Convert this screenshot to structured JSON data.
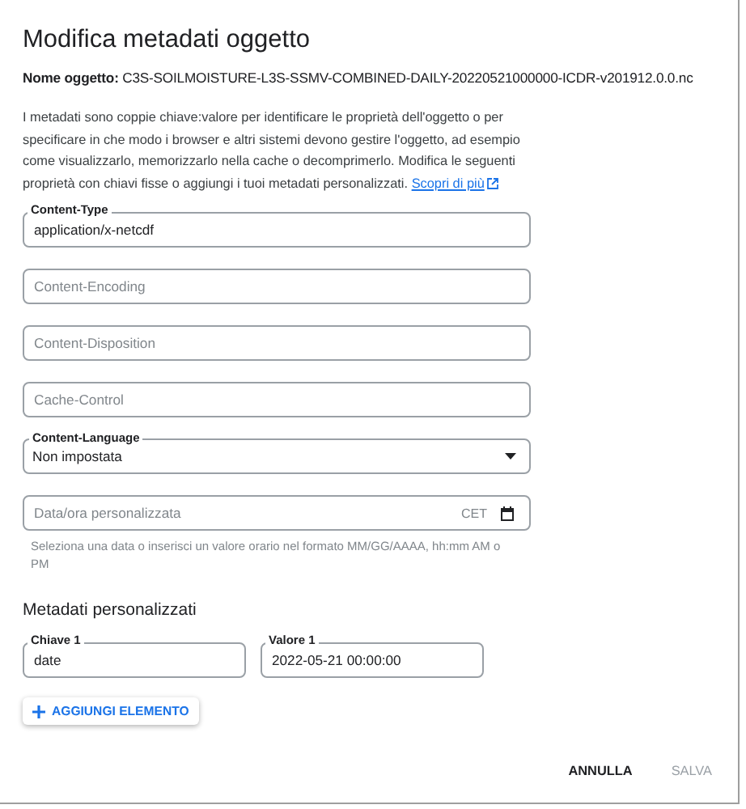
{
  "dialog": {
    "title": "Modifica metadati oggetto",
    "object_name_label": "Nome oggetto:",
    "object_name": "C3S-SOILMOISTURE-L3S-SSMV-COMBINED-DAILY-20220521000000-ICDR-v201912.0.0.nc",
    "description": "I metadati sono coppie chiave:valore per identificare le proprietà dell'oggetto o per specificare in che modo i browser e altri sistemi devono gestire l'oggetto, ad esempio come visualizzarlo, memorizzarlo nella cache o decomprimerlo. Modifica le seguenti proprietà con chiavi fisse o aggiungi i tuoi metadati personalizzati.",
    "learn_more_link": "Scopri di più"
  },
  "fields": [
    {
      "kind": "text",
      "label": "Content-Type",
      "value": "application/x-netcdf"
    },
    {
      "kind": "text",
      "placeholder": "Content-Encoding"
    },
    {
      "kind": "text",
      "placeholder": "Content-Disposition"
    },
    {
      "kind": "text",
      "placeholder": "Cache-Control"
    },
    {
      "kind": "select",
      "label": "Content-Language",
      "value": "Non impostata"
    },
    {
      "kind": "datetime",
      "placeholder": "Data/ora personalizzata",
      "suffix": "CET",
      "hint": "Seleziona una data o inserisci un valore orario nel formato MM/GG/AAAA, hh:mm AM o PM"
    }
  ],
  "custom_metadata": {
    "title": "Metadati personalizzati",
    "entries": [
      {
        "key_label": "Chiave 1",
        "key": "date",
        "value_label": "Valore 1",
        "value": "2022-05-21 00:00:00"
      }
    ],
    "add_button": "AGGIUNGI ELEMENTO"
  },
  "actions": [
    {
      "label": "ANNULLA",
      "disabled": false
    },
    {
      "label": "SALVA",
      "disabled": true
    }
  ]
}
